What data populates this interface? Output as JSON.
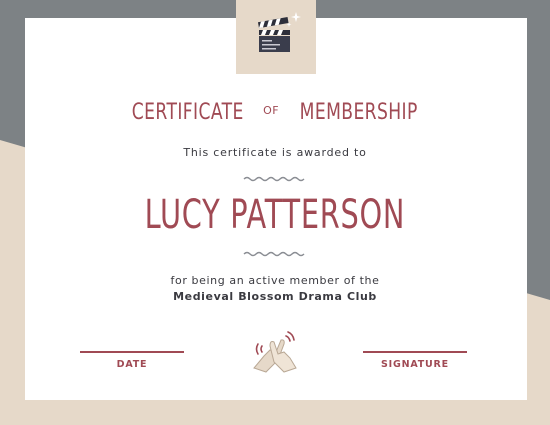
{
  "certificate": {
    "title_part1": "CERTIFICATE",
    "title_connector": "OF",
    "title_part2": "MEMBERSHIP",
    "subtitle": "This certificate is awarded to",
    "recipient_name": "LUCY PATTERSON",
    "reason_line": "for being an active member of the",
    "organization": "Medieval Blossom Drama Club",
    "date_label": "DATE",
    "signature_label": "SIGNATURE"
  },
  "icons": {
    "top": "clapperboard-icon",
    "bottom": "clapping-hands-icon"
  },
  "colors": {
    "accent": "#a04a54",
    "text": "#3a3a40",
    "gray_band": "#7d8285",
    "beige": "#e6d9c9",
    "card": "#ffffff"
  }
}
